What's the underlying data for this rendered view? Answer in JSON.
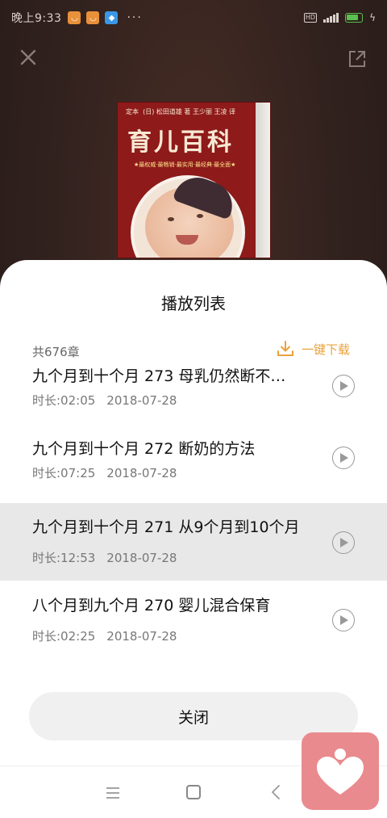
{
  "status_bar": {
    "time": "晚上9:33",
    "dots": "···",
    "hd": "HD",
    "battery_color": "#5ac14c"
  },
  "player": {
    "cover": {
      "title": "育儿百科",
      "top_label": "定本",
      "author_line": "(日) 松田道雄 著   王少丽 王凌 译",
      "subtitle": "★最权威·最畅销·最实用·最经典·最全面★"
    }
  },
  "sheet": {
    "title": "播放列表",
    "count_label": "共676章",
    "download_label": "一键下载",
    "accent_color": "#e9a23b",
    "items": [
      {
        "title": "九个月到十个月 273 母乳仍然断不…",
        "duration": "时长:02:05",
        "date": "2018-07-28",
        "active": false
      },
      {
        "title": "九个月到十个月 272 断奶的方法",
        "duration": "时长:07:25",
        "date": "2018-07-28",
        "active": false
      },
      {
        "title": "九个月到十个月 271 从9个月到10个月",
        "duration": "时长:12:53",
        "date": "2018-07-28",
        "active": true
      },
      {
        "title": "八个月到九个月 270 婴儿混合保育",
        "duration": "时长:02:25",
        "date": "2018-07-28",
        "active": false
      }
    ],
    "close_label": "关闭"
  },
  "navbar": {
    "icons": [
      "menu-icon",
      "home-icon",
      "back-icon"
    ]
  },
  "floating_app": {
    "icon": "heart-person-icon",
    "color": "#e98a8e"
  }
}
